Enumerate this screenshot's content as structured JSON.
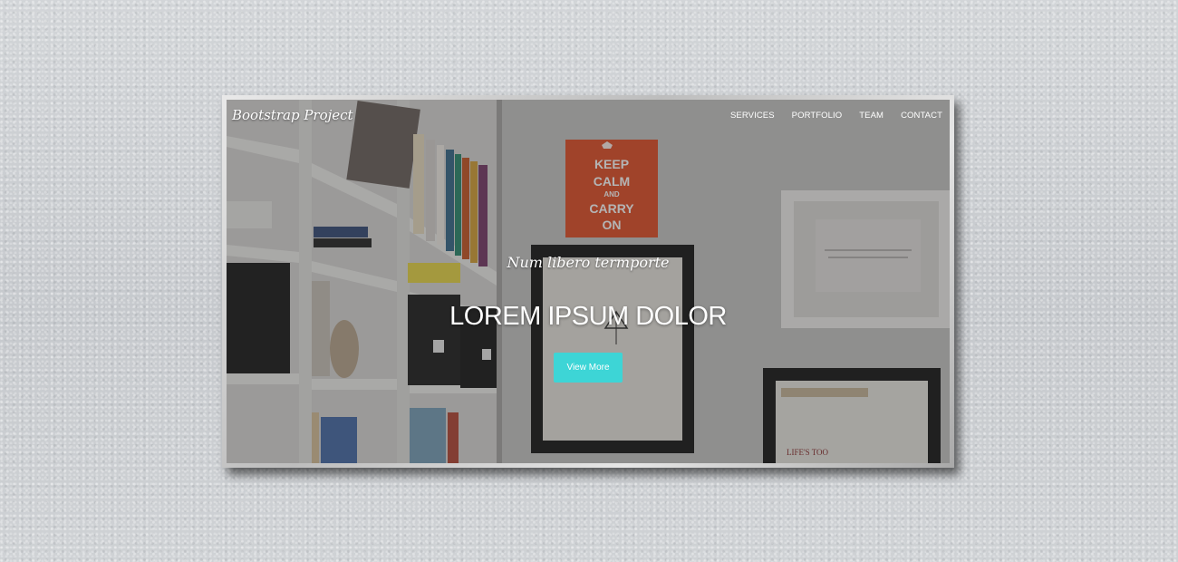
{
  "navbar": {
    "brand": "Bootstrap Project",
    "links": [
      "SERVICES",
      "PORTFOLIO",
      "TEAM",
      "CONTACT"
    ]
  },
  "hero": {
    "subtitle": "Num libero termporte",
    "title": "LOREM IPSUM DOLOR",
    "button_label": "View More"
  },
  "poster": {
    "lines": [
      "KEEP",
      "CALM",
      "AND",
      "CARRY",
      "ON"
    ]
  },
  "colors": {
    "accent": "#3dd5d6",
    "poster_red": "#e0522c"
  }
}
